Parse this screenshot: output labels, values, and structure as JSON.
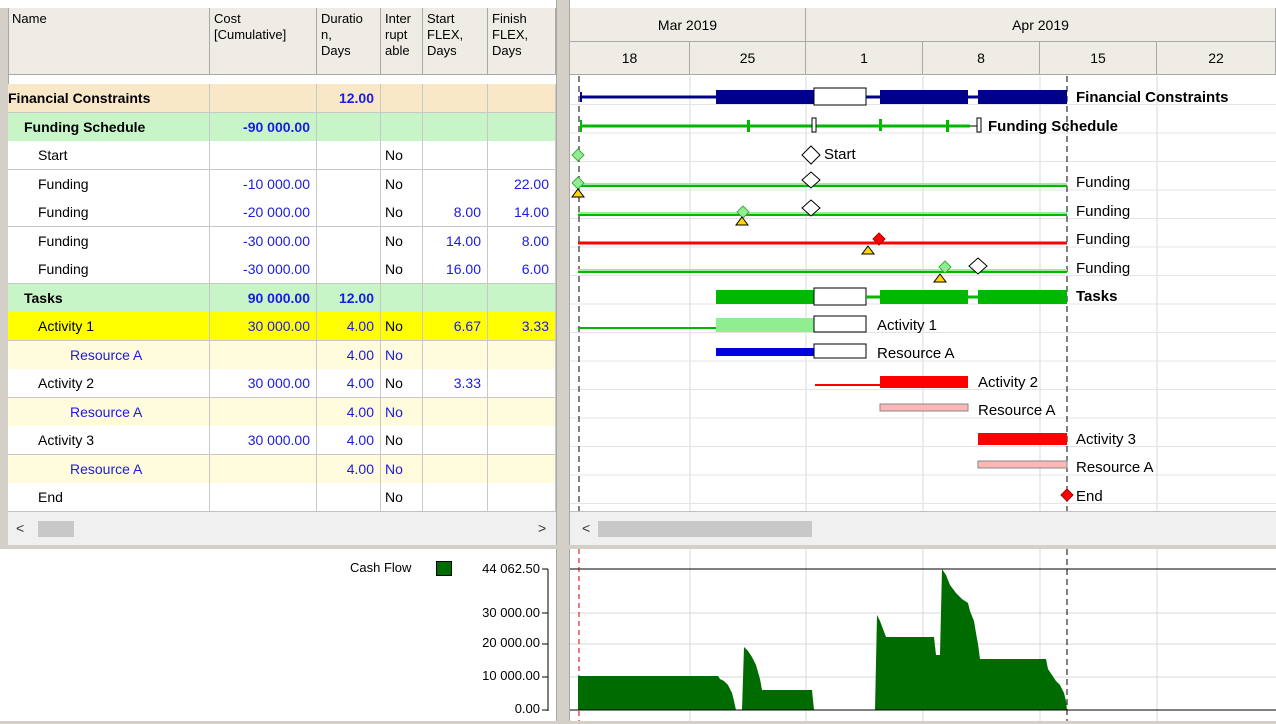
{
  "columns": {
    "name": "Name",
    "cost": "Cost\n[Cumulative]",
    "duration": "Duratio\nn,\nDays",
    "interruptable": "Inter\nrupt\nable",
    "start_flex": "Start\nFLEX,\nDays",
    "finish_flex": "Finish\nFLEX,\nDays"
  },
  "rows": [
    {
      "name": "Financial Constraints",
      "cost": "",
      "duration": "12.00",
      "interruptable": "",
      "start_flex": "",
      "finish_flex": "",
      "style": "summary1"
    },
    {
      "name": "Funding Schedule",
      "cost": "-90 000.00",
      "duration": "",
      "interruptable": "",
      "start_flex": "",
      "finish_flex": "",
      "style": "summary2"
    },
    {
      "name": "Start",
      "cost": "",
      "duration": "",
      "interruptable": "No",
      "start_flex": "",
      "finish_flex": "",
      "style": "task"
    },
    {
      "name": "Funding",
      "cost": "-10 000.00",
      "duration": "",
      "interruptable": "No",
      "start_flex": "",
      "finish_flex": "22.00",
      "style": "task"
    },
    {
      "name": "Funding",
      "cost": "-20 000.00",
      "duration": "",
      "interruptable": "No",
      "start_flex": "8.00",
      "finish_flex": "14.00",
      "style": "task"
    },
    {
      "name": "Funding",
      "cost": "-30 000.00",
      "duration": "",
      "interruptable": "No",
      "start_flex": "14.00",
      "finish_flex": "8.00",
      "style": "task"
    },
    {
      "name": "Funding",
      "cost": "-30 000.00",
      "duration": "",
      "interruptable": "No",
      "start_flex": "16.00",
      "finish_flex": "6.00",
      "style": "task"
    },
    {
      "name": "Tasks",
      "cost": "90 000.00",
      "duration": "12.00",
      "interruptable": "",
      "start_flex": "",
      "finish_flex": "",
      "style": "summary2"
    },
    {
      "name": "Activity 1",
      "cost": "30 000.00",
      "duration": "4.00",
      "interruptable": "No",
      "start_flex": "6.67",
      "finish_flex": "3.33",
      "style": "selected"
    },
    {
      "name": "Resource A",
      "cost": "",
      "duration": "4.00",
      "interruptable": "No",
      "start_flex": "",
      "finish_flex": "",
      "style": "resource"
    },
    {
      "name": "Activity 2",
      "cost": "30 000.00",
      "duration": "4.00",
      "interruptable": "No",
      "start_flex": "3.33",
      "finish_flex": "",
      "style": "task"
    },
    {
      "name": "Resource A",
      "cost": "",
      "duration": "4.00",
      "interruptable": "No",
      "start_flex": "",
      "finish_flex": "",
      "style": "resource"
    },
    {
      "name": "Activity 3",
      "cost": "30 000.00",
      "duration": "4.00",
      "interruptable": "No",
      "start_flex": "",
      "finish_flex": "",
      "style": "task"
    },
    {
      "name": "Resource A",
      "cost": "",
      "duration": "4.00",
      "interruptable": "No",
      "start_flex": "",
      "finish_flex": "",
      "style": "resource"
    },
    {
      "name": "End",
      "cost": "",
      "duration": "",
      "interruptable": "No",
      "start_flex": "",
      "finish_flex": "",
      "style": "task"
    }
  ],
  "timeline": {
    "months": [
      "Mar 2019",
      "Apr 2019"
    ],
    "weeks": [
      "18",
      "25",
      "1",
      "8",
      "15",
      "22"
    ]
  },
  "gantt_labels": {
    "financial": "Financial Constraints",
    "funding_schedule": "Funding Schedule",
    "start": "Start",
    "funding": "Funding",
    "tasks": "Tasks",
    "activity1": "Activity 1",
    "resource": "Resource A",
    "activity2": "Activity 2",
    "activity3": "Activity 3",
    "end": "End"
  },
  "cashflow": {
    "legend": "Cash Flow",
    "ticks": [
      "44 062.50",
      "30 000.00",
      "20 000.00",
      "10 000.00",
      "0.00"
    ]
  },
  "colors": {
    "summary1": "#f9e8c8",
    "summary2": "#c8f5c8",
    "selected": "#ffff00",
    "resource": "#fffbdc",
    "navy": "#00008b",
    "green": "#00b800",
    "darkgreen": "#006b00",
    "red": "#ff0000"
  }
}
